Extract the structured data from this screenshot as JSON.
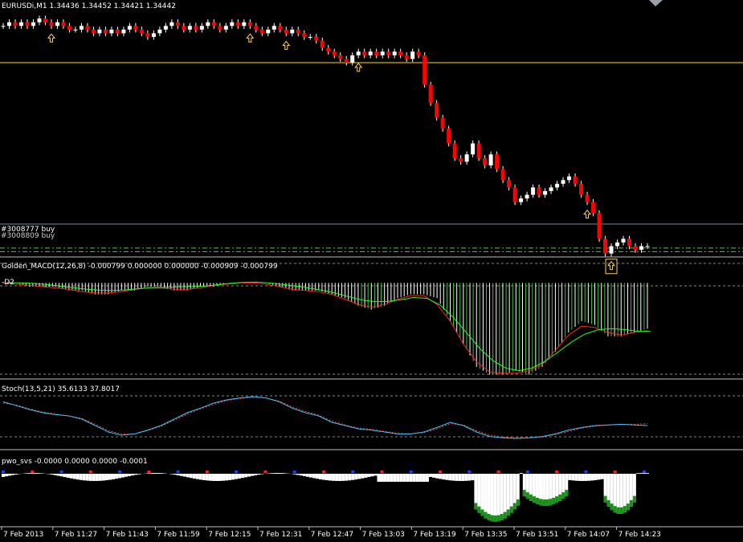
{
  "header": {
    "title": "EURUSDi,M1",
    "ohlc": "1.34436 1.34452 1.34421 1.34442"
  },
  "order_labels": [
    "#3008777 buy",
    "#3008809 buy"
  ],
  "indicators": {
    "macd_title": "Golden_MACD(12,26,8) -0.000799 0.000000 0.000000 -0.000909 -0.000799",
    "macd_sub": "-D2",
    "stoch_title": "Stoch(13,5,21) 35.6133 37.8017",
    "pwo_title": "pwo_svs -0.0000 0.0000 0.0000 -0.0001"
  },
  "time_axis": {
    "labels": [
      "7 Feb 2013",
      "7 Feb 11:27",
      "7 Feb 11:43",
      "7 Feb 11:59",
      "7 Feb 12:15",
      "7 Feb 12:31",
      "7 Feb 12:47",
      "7 Feb 13:03",
      "7 Feb 13:19",
      "7 Feb 13:35",
      "7 Feb 13:51",
      "7 Feb 14:07",
      "7 Feb 14:23"
    ]
  },
  "colors": {
    "background": "#000000",
    "bull_candle": "#ffffff",
    "bear_candle": "#ff0000",
    "horizontal_line": "#ffd700",
    "order_lines": "#6abf4b",
    "arrows": "#ffd24d",
    "macd_main": "#ff2020",
    "macd_signal": "#20ff20",
    "stoch_main": "#40c0ff",
    "stoch_signal": "#ff4040"
  },
  "chart_data": [
    {
      "type": "candlestick",
      "title": "EURUSDi,M1",
      "x_start": "7 Feb 2013 11:11",
      "x_step_minutes": 1,
      "close": [
        1.3468,
        1.3469,
        1.3468,
        1.3469,
        1.3468,
        1.3469,
        1.347,
        1.3469,
        1.3468,
        1.3469,
        1.3468,
        1.3467,
        1.3467,
        1.3468,
        1.3467,
        1.3466,
        1.3467,
        1.3466,
        1.3467,
        1.3466,
        1.3467,
        1.3468,
        1.3467,
        1.3466,
        1.3465,
        1.3466,
        1.3467,
        1.3468,
        1.3469,
        1.3468,
        1.3467,
        1.3468,
        1.3467,
        1.3468,
        1.3469,
        1.3468,
        1.3467,
        1.3468,
        1.3469,
        1.3468,
        1.3469,
        1.3468,
        1.3467,
        1.3466,
        1.3467,
        1.3468,
        1.3467,
        1.3466,
        1.3467,
        1.3466,
        1.3465,
        1.3465,
        1.3464,
        1.3462,
        1.3461,
        1.346,
        1.3459,
        1.3458,
        1.346,
        1.3461,
        1.346,
        1.3461,
        1.346,
        1.3461,
        1.346,
        1.3461,
        1.346,
        1.3459,
        1.3461,
        1.346,
        1.3452,
        1.3447,
        1.3443,
        1.344,
        1.3436,
        1.3432,
        1.3431,
        1.3433,
        1.3436,
        1.3432,
        1.343,
        1.3433,
        1.3429,
        1.3426,
        1.3424,
        1.342,
        1.3421,
        1.3422,
        1.3424,
        1.3422,
        1.3423,
        1.3424,
        1.3425,
        1.3426,
        1.3427,
        1.3425,
        1.3422,
        1.342,
        1.3417,
        1.341,
        1.3406,
        1.3408,
        1.3409,
        1.341,
        1.3408,
        1.3407,
        1.3408,
        1.3408
      ],
      "horizontal_line": 1.3458,
      "order_levels": [
        1.34075,
        1.34065
      ],
      "ylim": [
        1.34055,
        1.3472
      ]
    },
    {
      "type": "histogram+line",
      "title": "Golden_MACD(12,26,8)",
      "series": [
        {
          "name": "main"
        },
        {
          "name": "signal"
        }
      ],
      "histogram": [
        0.0,
        0.0,
        -0.0001,
        -0.0001,
        -0.0001,
        -0.0002,
        -0.0002,
        -0.0003,
        -0.0003,
        -0.0002,
        -0.0002,
        -0.0001,
        -0.0001,
        -0.0002,
        -0.0002,
        -0.0001,
        -0.0001,
        0.0,
        0.0,
        0.0,
        0.0,
        -0.0001,
        -0.0002,
        -0.0002,
        -0.0002,
        -0.0003,
        -0.0004,
        -0.0006,
        -0.0007,
        -0.0006,
        -0.0004,
        -0.0003,
        -0.0003,
        -0.0004,
        -0.001,
        -0.0016,
        -0.0022,
        -0.0024,
        -0.0024,
        -0.0023,
        -0.0024,
        -0.0022,
        -0.0018,
        -0.0013,
        -0.001,
        -0.0011,
        -0.0014,
        -0.0014,
        -0.0013,
        -0.0012
      ],
      "ylim": [
        -0.0026,
        0.0003
      ]
    },
    {
      "type": "line",
      "title": "Stoch(13,5,21)",
      "series": [
        {
          "name": "main"
        },
        {
          "name": "signal"
        }
      ],
      "main": [
        72,
        66,
        60,
        55,
        52,
        50,
        45,
        35,
        25,
        20,
        22,
        28,
        35,
        45,
        55,
        62,
        70,
        75,
        78,
        80,
        78,
        72,
        62,
        55,
        50,
        40,
        35,
        30,
        28,
        25,
        22,
        22,
        25,
        32,
        40,
        35,
        25,
        18,
        16,
        15,
        16,
        18,
        22,
        28,
        32,
        35,
        36,
        37,
        36,
        35
      ],
      "signal": [
        70,
        67,
        61,
        56,
        53,
        50,
        46,
        37,
        27,
        22,
        22,
        27,
        34,
        43,
        53,
        61,
        68,
        74,
        77,
        79,
        78,
        73,
        64,
        57,
        51,
        42,
        36,
        31,
        29,
        26,
        23,
        22,
        24,
        30,
        38,
        36,
        27,
        20,
        17,
        16,
        16,
        17,
        21,
        26,
        31,
        34,
        36,
        37,
        37,
        38
      ],
      "levels": [
        80,
        20
      ],
      "ylim": [
        0,
        100
      ]
    }
  ]
}
